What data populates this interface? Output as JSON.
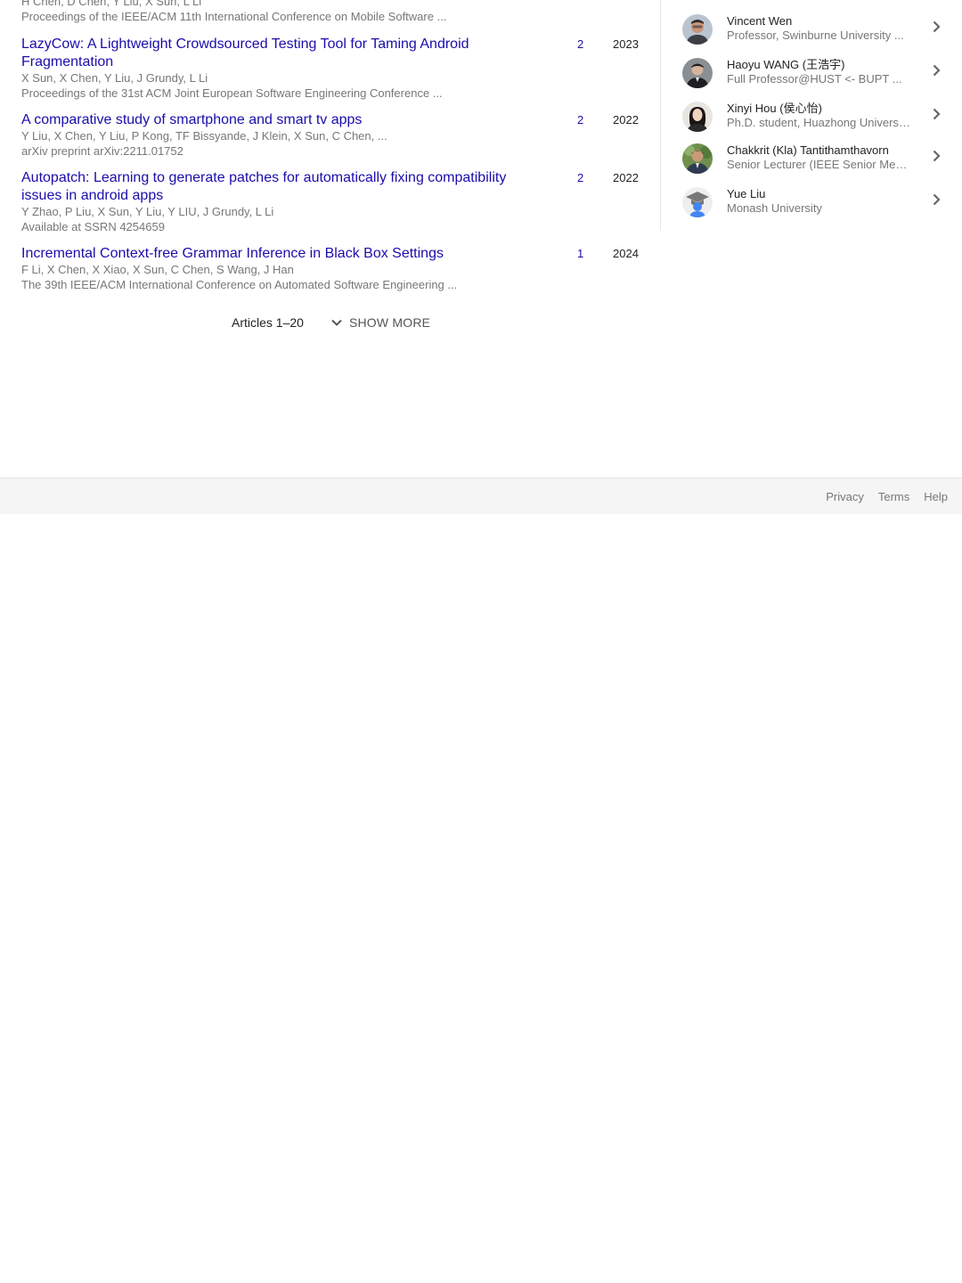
{
  "articles": [
    {
      "title": "",
      "authors": "H Chen, D Chen, Y Liu, X Sun, L Li",
      "venue": "Proceedings of the IEEE/ACM 11th International Conference on Mobile Software ...",
      "cites": "",
      "year": ""
    },
    {
      "title": "LazyCow: A Lightweight Crowdsourced Testing Tool for Taming Android Fragmentation",
      "authors": "X Sun, X Chen, Y Liu, J Grundy, L Li",
      "venue": "Proceedings of the 31st ACM Joint European Software Engineering Conference ...",
      "cites": "2",
      "year": "2023"
    },
    {
      "title": "A comparative study of smartphone and smart tv apps",
      "authors": "Y Liu, X Chen, Y Liu, P Kong, TF Bissyande, J Klein, X Sun, C Chen, ...",
      "venue": "arXiv preprint arXiv:2211.01752",
      "cites": "2",
      "year": "2022"
    },
    {
      "title": "Autopatch: Learning to generate patches for automatically fixing compatibility issues in android apps",
      "authors": "Y Zhao, P Liu, X Sun, Y Liu, Y LIU, J Grundy, L Li",
      "venue": "Available at SSRN 4254659",
      "cites": "2",
      "year": "2022"
    },
    {
      "title": "Incremental Context-free Grammar Inference in Black Box Settings",
      "authors": "F Li, X Chen, X Xiao, X Sun, C Chen, S Wang, J Han",
      "venue": "The 39th IEEE/ACM International Conference on Automated Software Engineering ...",
      "cites": "1",
      "year": "2024"
    }
  ],
  "pager": {
    "range": "Articles 1–20",
    "show_more": "SHOW MORE"
  },
  "coauthors": [
    {
      "name": "Vincent Wen",
      "affiliation": "Professor, Swinburne University ...",
      "avatar": "photo-avatar"
    },
    {
      "name": "Haoyu WANG (王浩宇)",
      "affiliation": "Full Professor@HUST <- BUPT ...",
      "avatar": "photo-avatar"
    },
    {
      "name": "Xinyi Hou (侯心怡)",
      "affiliation": "Ph.D. student, Huazhong University ...",
      "avatar": "photo-avatar"
    },
    {
      "name": "Chakkrit (Kla) Tantithamthavorn",
      "affiliation": "Senior Lecturer (IEEE Senior Member) ...",
      "avatar": "photo-avatar"
    },
    {
      "name": "Yue Liu",
      "affiliation": "Monash University",
      "avatar": "default-scholar-avatar"
    }
  ],
  "footer": {
    "privacy": "Privacy",
    "terms": "Terms",
    "help": "Help"
  },
  "colors": {
    "link": "#1a0dab",
    "muted": "#777777",
    "footer_bg": "#f5f5f5"
  }
}
